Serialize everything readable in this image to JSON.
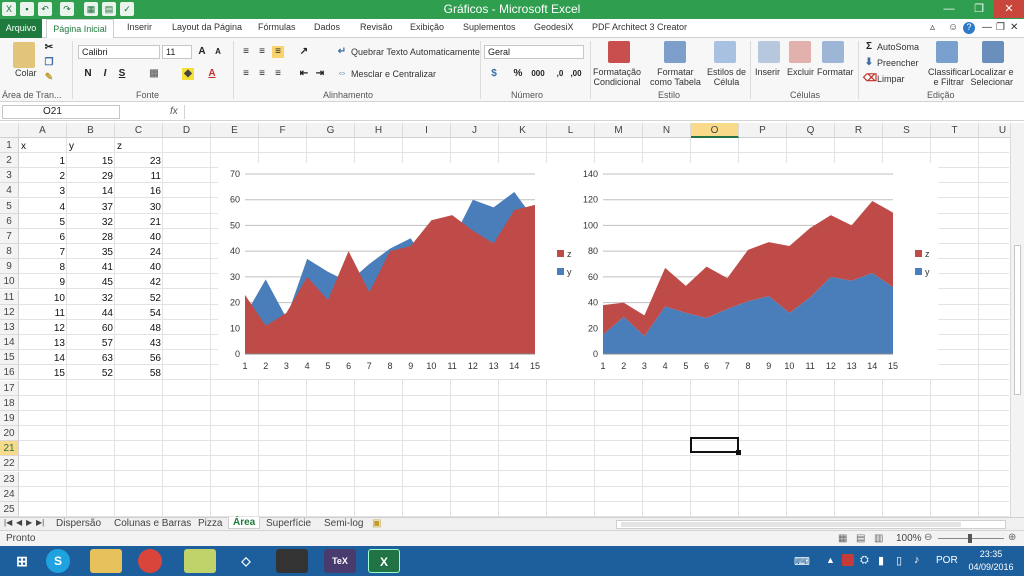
{
  "window": {
    "title": "Gráficos - Microsoft Excel"
  },
  "ribbon_tabs": [
    "Página Inicial",
    "Inserir",
    "Layout da Página",
    "Fórmulas",
    "Dados",
    "Revisão",
    "Exibição",
    "Suplementos",
    "GeodesiX",
    "PDF Architect 3 Creator"
  ],
  "file_tab": "Arquivo",
  "ribbon": {
    "clipboard": {
      "paste": "Colar",
      "group": "Área de Tran..."
    },
    "font": {
      "name": "Calibri",
      "size": "11",
      "group": "Fonte"
    },
    "alignment": {
      "wrap": "Quebrar Texto Automaticamente",
      "merge": "Mesclar e Centralizar",
      "group": "Alinhamento"
    },
    "number": {
      "format": "Geral",
      "group": "Número"
    },
    "styles": {
      "conditional": "Formatação\nCondicional",
      "table": "Formatar\ncomo Tabela",
      "cell": "Estilos de\nCélula",
      "group": "Estilo"
    },
    "cells": {
      "insert": "Inserir",
      "delete": "Excluir",
      "format": "Formatar",
      "group": "Células"
    },
    "editing": {
      "autosum": "AutoSoma",
      "fill": "Preencher",
      "clear": "Limpar",
      "sort": "Classificar\ne Filtrar",
      "find": "Localizar e\nSelecionar",
      "group": "Edição"
    }
  },
  "formula_bar": {
    "name_box": "O21",
    "fx": "fx",
    "formula": ""
  },
  "columns": [
    "A",
    "B",
    "C",
    "D",
    "E",
    "F",
    "G",
    "H",
    "I",
    "J",
    "K",
    "L",
    "M",
    "N",
    "O",
    "P",
    "Q",
    "R",
    "S",
    "T",
    "U"
  ],
  "selected_column": "O",
  "rows": [
    "1",
    "2",
    "3",
    "4",
    "5",
    "6",
    "7",
    "8",
    "9",
    "10",
    "11",
    "12",
    "13",
    "14",
    "15",
    "16",
    "17",
    "18",
    "19",
    "20",
    "21",
    "22",
    "23",
    "24",
    "25"
  ],
  "selected_row": "21",
  "headers": [
    "x",
    "y",
    "z"
  ],
  "table": [
    [
      1,
      15,
      23
    ],
    [
      2,
      29,
      11
    ],
    [
      3,
      14,
      16
    ],
    [
      4,
      37,
      30
    ],
    [
      5,
      32,
      21
    ],
    [
      6,
      28,
      40
    ],
    [
      7,
      35,
      24
    ],
    [
      8,
      41,
      40
    ],
    [
      9,
      45,
      42
    ],
    [
      10,
      32,
      52
    ],
    [
      11,
      44,
      54
    ],
    [
      12,
      60,
      48
    ],
    [
      13,
      57,
      43
    ],
    [
      14,
      63,
      56
    ],
    [
      15,
      52,
      58
    ]
  ],
  "chart_data": [
    {
      "type": "area",
      "stacked": false,
      "x": [
        1,
        2,
        3,
        4,
        5,
        6,
        7,
        8,
        9,
        10,
        11,
        12,
        13,
        14,
        15
      ],
      "series": [
        {
          "name": "y",
          "values": [
            15,
            29,
            14,
            37,
            32,
            28,
            35,
            41,
            45,
            32,
            44,
            60,
            57,
            63,
            52
          ],
          "color": "#4a7ebb"
        },
        {
          "name": "z",
          "values": [
            23,
            11,
            16,
            30,
            21,
            40,
            24,
            40,
            42,
            52,
            54,
            48,
            43,
            56,
            58
          ],
          "color": "#be4b48"
        }
      ],
      "ylim": [
        0,
        70
      ],
      "yticks": [
        0,
        10,
        20,
        30,
        40,
        50,
        60,
        70
      ],
      "grid": true,
      "legend": "right"
    },
    {
      "type": "area",
      "stacked": true,
      "x": [
        1,
        2,
        3,
        4,
        5,
        6,
        7,
        8,
        9,
        10,
        11,
        12,
        13,
        14,
        15
      ],
      "series": [
        {
          "name": "y",
          "values": [
            15,
            29,
            14,
            37,
            32,
            28,
            35,
            41,
            45,
            32,
            44,
            60,
            57,
            63,
            52
          ],
          "color": "#4a7ebb"
        },
        {
          "name": "z",
          "values": [
            23,
            11,
            16,
            30,
            21,
            40,
            24,
            40,
            42,
            52,
            54,
            48,
            43,
            56,
            58
          ],
          "color": "#be4b48"
        }
      ],
      "ylim": [
        0,
        140
      ],
      "yticks": [
        0,
        20,
        40,
        60,
        80,
        100,
        120,
        140
      ],
      "grid": true,
      "legend": "right"
    }
  ],
  "sheet_tabs": [
    "Dispersão",
    "Colunas e Barras",
    "Pizza",
    "Área",
    "Superfície",
    "Semi-log"
  ],
  "active_sheet": "Área",
  "status": {
    "ready": "Pronto",
    "zoom": "100%"
  },
  "taskbar": {
    "lang": "POR",
    "time": "23:35",
    "date": "04/09/2016"
  },
  "colors": {
    "excel_green": "#217346",
    "title_green": "#2f9e4f",
    "selected_header": "#f9d98a",
    "taskbar": "#1c5f9c"
  }
}
